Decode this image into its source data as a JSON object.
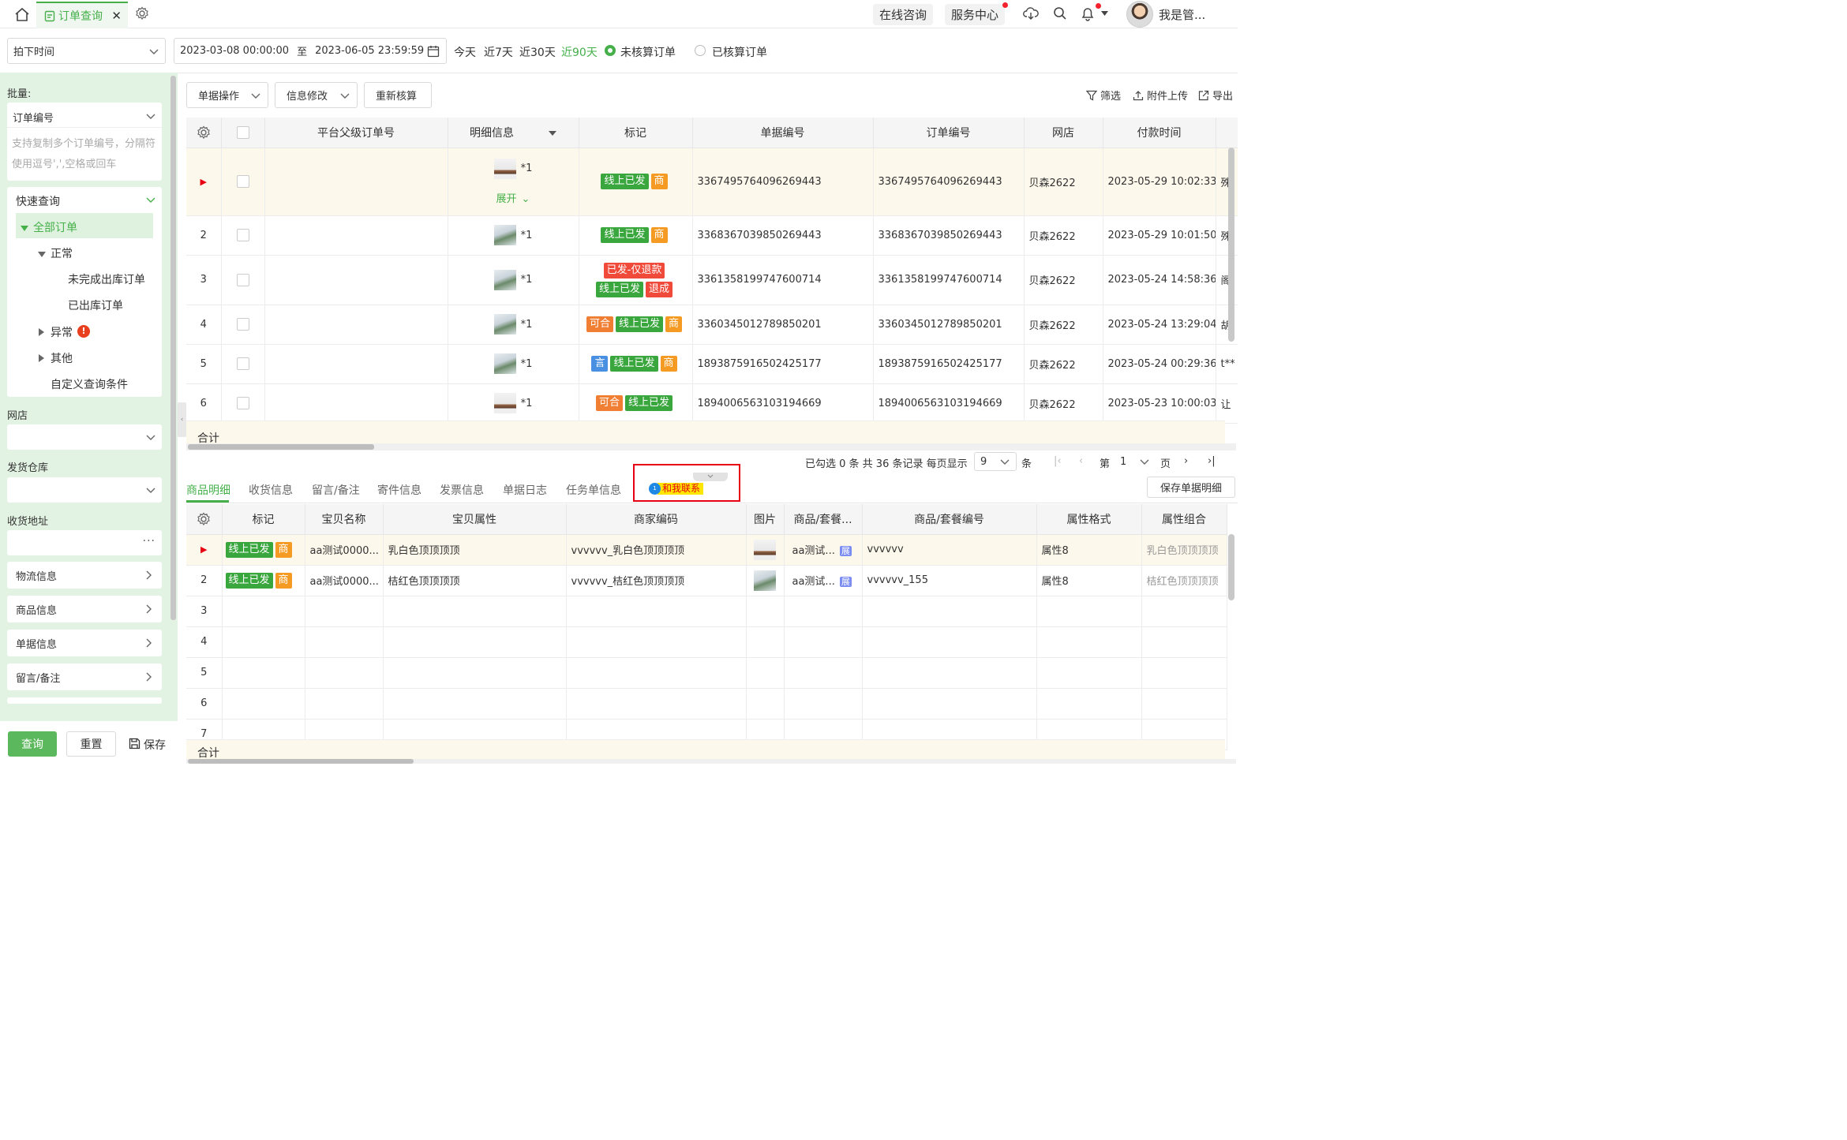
{
  "header": {
    "tab_title": "订单查询",
    "online_consult": "在线咨询",
    "service_center": "服务中心",
    "user_name": "我是管..."
  },
  "filters": {
    "time_type": "拍下时间",
    "date_start": "2023-03-08 00:00:00",
    "date_to": "至",
    "date_end": "2023-06-05 23:59:59",
    "quick_ranges": [
      "今天",
      "近7天",
      "近30天",
      "近90天"
    ],
    "active_range": "近90天",
    "radio_unsettled": "未核算订单",
    "radio_settled": "已核算订单"
  },
  "sidebar": {
    "batch_label": "批量:",
    "batch_field": "订单编号",
    "batch_placeholder": "支持复制多个订单编号，分隔符使用逗号',',空格或回车",
    "quick_query": "快速查询",
    "tree": {
      "all": "全部订单",
      "normal": "正常",
      "unfinished": "未完成出库订单",
      "shipped": "已出库订单",
      "abnormal": "异常",
      "other": "其他",
      "custom": "自定义查询条件"
    },
    "shop_label": "网店",
    "warehouse_label": "发货仓库",
    "address_label": "收货地址",
    "sections": [
      "物流信息",
      "商品信息",
      "单据信息",
      "留言/备注"
    ],
    "query_btn": "查询",
    "reset_btn": "重置",
    "save_btn": "保存"
  },
  "toolbar": {
    "doc_ops": "单据操作",
    "info_edit": "信息修改",
    "recalc": "重新核算",
    "filter": "筛选",
    "upload": "附件上传",
    "export": "导出"
  },
  "orders": {
    "columns": [
      "平台父级订单号",
      "明细信息",
      "标记",
      "单据编号",
      "订单编号",
      "网店",
      "付款时间"
    ],
    "expand_label": "展开",
    "total_label": "合计",
    "rows": [
      {
        "no": "",
        "qty": "*1",
        "tags": [
          [
            "线上已发",
            "tg"
          ],
          [
            "商",
            "to"
          ]
        ],
        "doc": "3367495764096269443",
        "order": "3367495764096269443",
        "shop": "贝森2622",
        "paid": "2023-05-29 10:02:33",
        "extra": "殊",
        "img": "dog"
      },
      {
        "no": "2",
        "qty": "*1",
        "tags": [
          [
            "线上已发",
            "tg"
          ],
          [
            "商",
            "to"
          ]
        ],
        "doc": "3368367039850269443",
        "order": "3368367039850269443",
        "shop": "贝森2622",
        "paid": "2023-05-29 10:01:50",
        "extra": "殊",
        "img": "p"
      },
      {
        "no": "3",
        "qty": "*1",
        "tags": [
          [
            "已发-仅退款",
            "tr"
          ],
          [
            "线上已发",
            "tg"
          ],
          [
            "退成",
            "tr"
          ]
        ],
        "doc": "3361358199747600714",
        "order": "3361358199747600714",
        "shop": "贝森2622",
        "paid": "2023-05-24 14:58:36",
        "extra": "阁",
        "img": "p"
      },
      {
        "no": "4",
        "qty": "*1",
        "tags": [
          [
            "可合",
            "tc"
          ],
          [
            "线上已发",
            "tg"
          ],
          [
            "商",
            "to"
          ]
        ],
        "doc": "3360345012789850201",
        "order": "3360345012789850201",
        "shop": "贝森2622",
        "paid": "2023-05-24 13:29:04",
        "extra": "胡",
        "img": "p"
      },
      {
        "no": "5",
        "qty": "*1",
        "tags": [
          [
            "言",
            "tb"
          ],
          [
            "线上已发",
            "tg"
          ],
          [
            "商",
            "to"
          ]
        ],
        "doc": "1893875916502425177",
        "order": "1893875916502425177",
        "shop": "贝森2622",
        "paid": "2023-05-24 00:29:36",
        "extra": "t**",
        "img": "p"
      },
      {
        "no": "6",
        "qty": "*1",
        "tags": [
          [
            "可合",
            "tc"
          ],
          [
            "线上已发",
            "tg"
          ]
        ],
        "doc": "1894006563103194669",
        "order": "1894006563103194669",
        "shop": "贝森2622",
        "paid": "2023-05-23 10:00:03",
        "extra": "让",
        "img": "dog"
      }
    ]
  },
  "pagination": {
    "summary": "已勾选 0 条  共 36 条记录  每页显示",
    "page_size": "9",
    "unit": "条",
    "page_prefix": "第",
    "page": "1",
    "page_suffix": "页"
  },
  "detail_tabs": [
    "商品明细",
    "收货信息",
    "留言/备注",
    "寄件信息",
    "发票信息",
    "单据日志",
    "任务单信息"
  ],
  "contact_badge": "和我联系",
  "save_detail": "保存单据明细",
  "details": {
    "columns": [
      "标记",
      "宝贝名称",
      "宝贝属性",
      "商家编码",
      "图片",
      "商品/套餐...",
      "商品/套餐编号",
      "属性格式",
      "属性组合"
    ],
    "total_label": "合计",
    "rows": [
      {
        "no": "",
        "name": "aa测试0000...",
        "attr": "乳白色顶顶顶顶",
        "code": "vvvvvv_乳白色顶顶顶顶",
        "pkg": "aa测试...",
        "pkgno": "vvvvvv",
        "fmt": "属性8",
        "combo": "乳白色顶顶顶顶",
        "img": "dog"
      },
      {
        "no": "2",
        "name": "aa测试0000...",
        "attr": "桔红色顶顶顶顶",
        "code": "vvvvvv_桔红色顶顶顶顶",
        "pkg": "aa测试...",
        "pkgno": "vvvvvv_155",
        "fmt": "属性8",
        "combo": "桔红色顶顶顶顶",
        "img": "p"
      }
    ],
    "empty_rows": [
      "3",
      "4",
      "5",
      "6",
      "7"
    ],
    "tag1": "线上已发",
    "tag2": "商",
    "pkg_badge": "展"
  },
  "colors": {
    "accent": "#45b04a",
    "sidebar_bg": "#e3f3e3",
    "highlight": "#e60012"
  }
}
